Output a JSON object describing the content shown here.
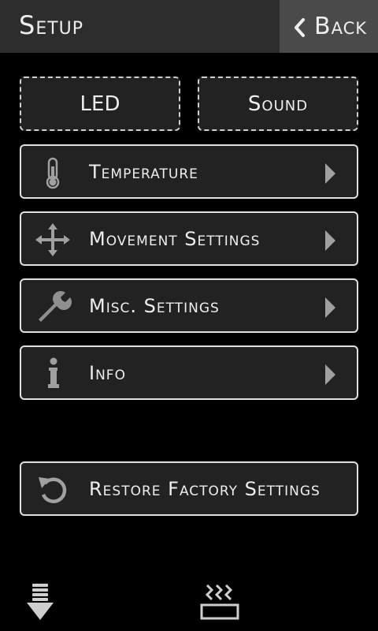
{
  "header": {
    "title": "Setup",
    "back_label": "Back"
  },
  "toggles": {
    "led_label": "LED",
    "sound_label": "Sound"
  },
  "menu": {
    "items": [
      {
        "label": "Temperature",
        "icon": "thermometer-icon"
      },
      {
        "label": "Movement Settings",
        "icon": "move-arrows-icon"
      },
      {
        "label": "Misc. Settings",
        "icon": "wrench-icon"
      },
      {
        "label": "Info",
        "icon": "info-icon"
      }
    ]
  },
  "restore": {
    "label": "Restore Factory Settings",
    "icon": "restore-icon"
  },
  "toolbar": {
    "icons": [
      "extrude-icon",
      "heated-bed-icon"
    ]
  },
  "colors": {
    "background": "#000000",
    "header_bg": "#2d2d2d",
    "back_bg": "#4a4a4a",
    "button_bg": "#222222",
    "button_border": "#e0e0e0",
    "text": "#eeeeee",
    "icon_gray": "#9a9a9a"
  }
}
